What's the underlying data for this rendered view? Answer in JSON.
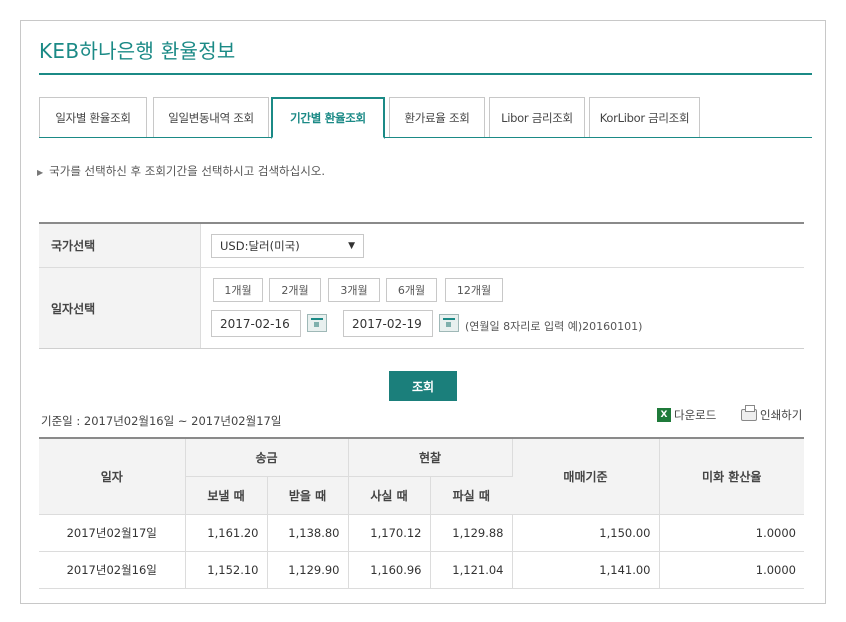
{
  "page": {
    "title": "KEB하나은행 환율정보"
  },
  "tabs": [
    {
      "label": "일자별 환율조회"
    },
    {
      "label": "일일변동내역 조회"
    },
    {
      "label": "기간별 환율조회",
      "active": true
    },
    {
      "label": "환가료율 조회"
    },
    {
      "label": "Libor 금리조회"
    },
    {
      "label": "KorLibor 금리조회"
    }
  ],
  "notice": "국가를 선택하신 후 조회기간을 선택하시고 검색하십시오.",
  "form": {
    "country_label": "국가선택",
    "country_value": "USD:달러(미국)",
    "date_label": "일자선택",
    "periods": [
      "1개월",
      "2개월",
      "3개월",
      "6개월",
      "12개월"
    ],
    "start_date": "2017-02-16",
    "end_date": "2017-02-19",
    "tilde": "~",
    "hint": "(연월일 8자리로 입력 예)20160101)"
  },
  "search_button": "조회",
  "basis_text": "기준일 : 2017년02월16일 ~ 2017년02월17일",
  "tools": {
    "download": "다운로드",
    "print": "인쇄하기",
    "xls_glyph": "X"
  },
  "table": {
    "headers": {
      "date": "일자",
      "transfer": "송금",
      "cash": "현찰",
      "base_rate": "매매기준",
      "usd_rate": "미화 환산율",
      "send": "보낼 때",
      "receive": "받을 때",
      "buy": "사실 때",
      "sell": "파실 때"
    },
    "rows": [
      {
        "date": "2017년02월17일",
        "send": "1,161.20",
        "receive": "1,138.80",
        "buy": "1,170.12",
        "sell": "1,129.88",
        "base": "1,150.00",
        "usd": "1.0000"
      },
      {
        "date": "2017년02월16일",
        "send": "1,152.10",
        "receive": "1,129.90",
        "buy": "1,160.96",
        "sell": "1,121.04",
        "base": "1,141.00",
        "usd": "1.0000"
      }
    ]
  },
  "colors": {
    "accent": "#1b8a86",
    "button": "#1b7f7b"
  }
}
